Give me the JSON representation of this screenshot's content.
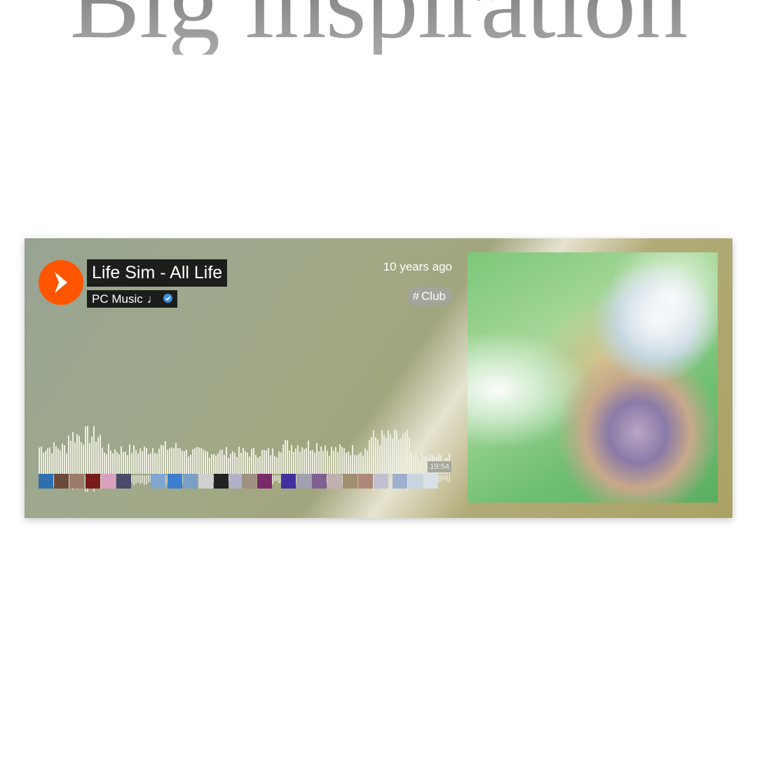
{
  "headline": "Big inspiration",
  "track": {
    "title": "Life Sim - All Life",
    "artist": "PC Music",
    "artist_note_glyph": "♩",
    "verified": true,
    "posted": "10 years ago",
    "tag_hash": "#",
    "tag": "Club",
    "duration": "19:54"
  },
  "icons": {
    "play": "play-icon",
    "verified": "verified-badge-icon",
    "note": "music-note-icon"
  },
  "colors": {
    "play_button": "#ff5500",
    "title_bg": "#1c1e1b",
    "verified": "#3b8fe3",
    "waveform": "#eeeee2"
  }
}
